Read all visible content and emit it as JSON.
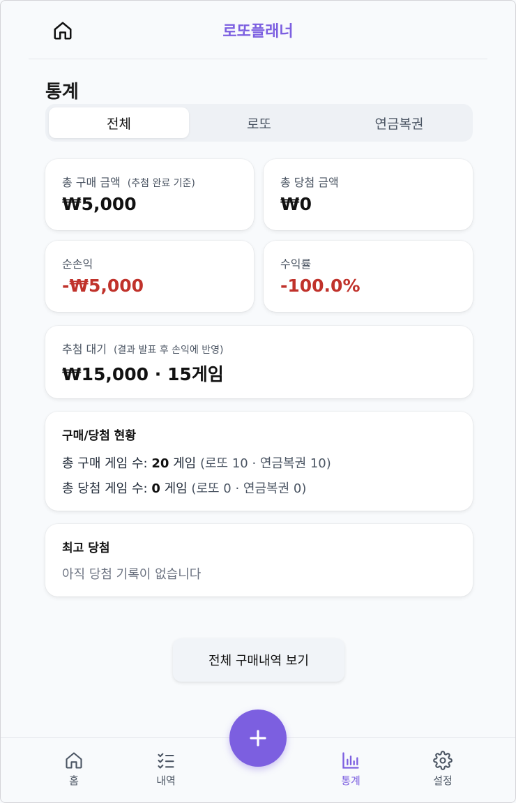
{
  "header": {
    "title": "로또플래너"
  },
  "page": {
    "title": "통계"
  },
  "tabs": [
    {
      "label": "전체",
      "active": true
    },
    {
      "label": "로또",
      "active": false
    },
    {
      "label": "연금복권",
      "active": false
    }
  ],
  "stats": {
    "total_purchase": {
      "label": "총 구매 금액",
      "note": "(추첨 완료 기준)",
      "value": "₩5,000"
    },
    "total_win": {
      "label": "총 당첨 금액",
      "value": "₩0"
    },
    "net_profit": {
      "label": "순손익",
      "value": "-₩5,000"
    },
    "return_rate": {
      "label": "수익률",
      "value": "-100.0%"
    },
    "pending": {
      "label": "추첨 대기",
      "note": "(결과 발표 후 손익에 반영)",
      "value": "₩15,000 · 15게임"
    }
  },
  "status": {
    "title": "구매/당첨 현황",
    "purchase_line": {
      "prefix": "총 구매 게임 수: ",
      "count": "20",
      "unit": " 게임 ",
      "detail": "(로또 10 · 연금복권 10)"
    },
    "win_line": {
      "prefix": "총 당첨 게임 수: ",
      "count": "0",
      "unit": " 게임 ",
      "detail": "(로또 0 · 연금복권 0)"
    }
  },
  "best_win": {
    "title": "최고 당첨",
    "empty_text": "아직 당첨 기록이 없습니다"
  },
  "history_button": {
    "label": "전체 구매내역 보기"
  },
  "nav": {
    "items": [
      {
        "label": "홈",
        "icon": "home-icon",
        "active": false
      },
      {
        "label": "내역",
        "icon": "checklist-icon",
        "active": false
      },
      {
        "label": "통계",
        "icon": "bar-chart-icon",
        "active": true
      },
      {
        "label": "설정",
        "icon": "gear-icon",
        "active": false
      }
    ],
    "fab_icon": "plus-icon"
  },
  "colors": {
    "accent": "#7c5fe0",
    "negative": "#c0322b"
  }
}
